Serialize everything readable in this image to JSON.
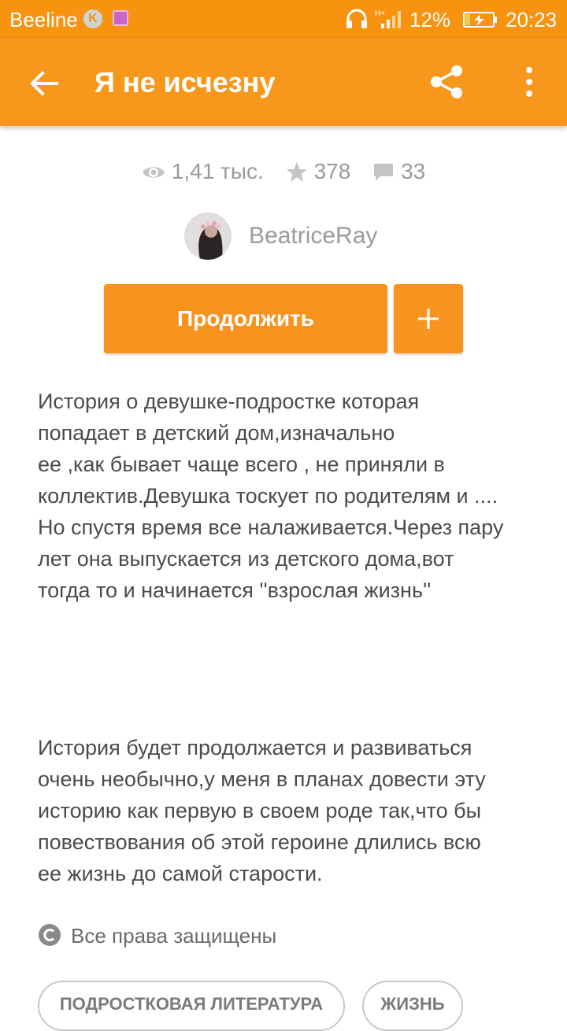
{
  "status_bar": {
    "carrier": "Beeline",
    "k_badge": "K",
    "battery_percent": "12%",
    "time": "20:23",
    "icons": [
      "k-badge-icon",
      "image-icon",
      "headphones-icon",
      "signal-icon",
      "battery-charging-icon"
    ]
  },
  "app_bar": {
    "title": "Я не исчезну",
    "icons": [
      "back-arrow-icon",
      "share-icon",
      "more-vert-icon"
    ]
  },
  "stats": {
    "views": "1,41 тыс.",
    "votes": "378",
    "comments": "33"
  },
  "author": {
    "name": "BeatriceRay"
  },
  "actions": {
    "continue_label": "Продолжить",
    "add_label": "+"
  },
  "description": {
    "paragraph1": [
      "История о девушке-подростке которая",
      "попадает в детский дом,изначально",
      "ее ,как бывает чаще всего , не приняли в",
      "коллектив.Девушка тоскует по родителям и ....",
      "Но спустя время все налаживается.Через пару",
      "лет она выпускается из детского дома,вот",
      "тогда то и начинается ''взрослая жизнь''"
    ],
    "paragraph2": [
      "История будет продолжается и развиваться",
      "очень необычно,у меня в планах довести эту",
      "историю как первую в своем роде так,что бы",
      "повествования об этой героине длились всю",
      "ее жизнь до самой старости."
    ]
  },
  "rights": "Все права защищены",
  "tags": [
    "ПОДРОСТКОВАЯ ЛИТЕРАТУРА",
    "ЖИЗНЬ"
  ],
  "colors": {
    "accent": "#f7931e",
    "status_bar": "#f7930f"
  }
}
